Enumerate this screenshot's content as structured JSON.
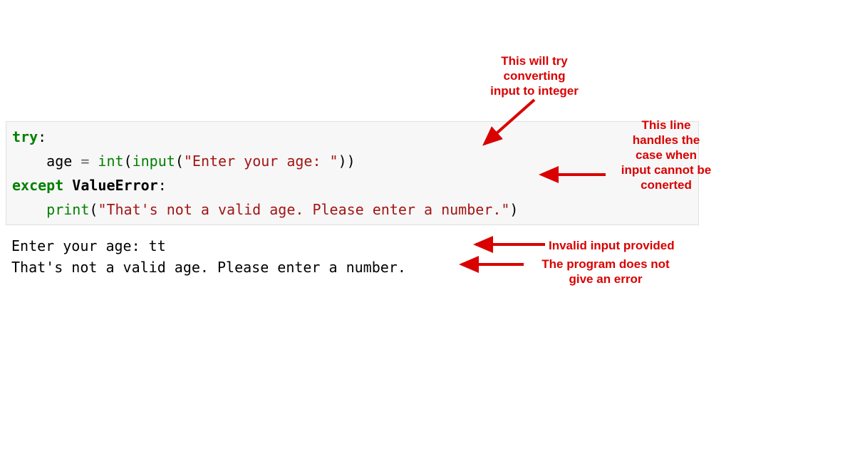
{
  "code": {
    "try_kw": "try",
    "colon1": ":",
    "indent": "    ",
    "var_age": "age",
    "assign": " = ",
    "int_fn": "int",
    "lparen1": "(",
    "input_fn": "input",
    "lparen2": "(",
    "prompt_str": "\"Enter your age: \"",
    "rparen2": ")",
    "rparen1": ")",
    "except_kw": "except",
    "space": " ",
    "exc_name": "ValueError",
    "colon2": ":",
    "print_fn": "print",
    "lparen3": "(",
    "err_str": "\"That's not a valid age. Please enter a number.\"",
    "rparen3": ")"
  },
  "output": {
    "line1": "Enter your age: tt",
    "line2": "That's not a valid age. Please enter a number."
  },
  "annotations": {
    "a1": "This will try\nconverting\ninput to integer",
    "a2": "This line\nhandles the\ncase when\ninput cannot be\nconerted",
    "a3": "Invalid input provided",
    "a4": "The program does not\ngive an error"
  },
  "colors": {
    "annotation": "#d90000"
  }
}
